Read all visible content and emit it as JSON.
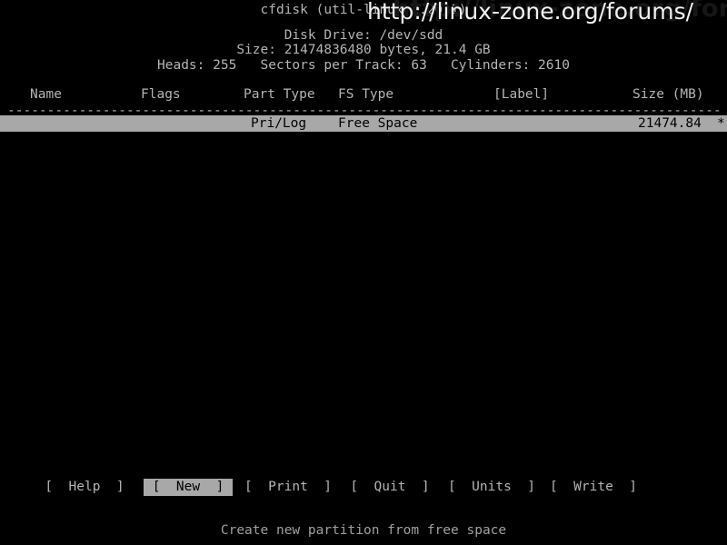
{
  "app": {
    "title": "cfdisk (util-linux 2.20.1)"
  },
  "disk_info": {
    "drive_line": "Disk Drive: /dev/sdd",
    "size_line": "Size: 21474836480 bytes, 21.4 GB",
    "geometry_line": "Heads: 255   Sectors per Track: 63   Cylinders: 2610",
    "drive": "/dev/sdd",
    "size_bytes": "21474836480",
    "size_human": "21.4 GB",
    "heads": "255",
    "sectors_per_track": "63",
    "cylinders": "2610"
  },
  "table": {
    "separator": "-------------------------------------------------------------------------------------------------------",
    "columns": {
      "name": "Name",
      "flags": "Flags",
      "part_type": "Part Type",
      "fs_type": "FS Type",
      "label": "[Label]",
      "size_mb": "Size (MB)"
    },
    "rows": [
      {
        "name": "",
        "flags": "",
        "part_type": "Pri/Log",
        "fs_type": "Free Space",
        "label": "",
        "size_mb": "21474.84",
        "more_marker": "*",
        "selected": true
      }
    ]
  },
  "buttons": [
    {
      "bracket_open": "[",
      "label": "Help",
      "bracket_close": "]",
      "selected": false
    },
    {
      "bracket_open": "[",
      "label": "New",
      "bracket_close": "]",
      "selected": true
    },
    {
      "bracket_open": "[",
      "label": "Print",
      "bracket_close": "]",
      "selected": false
    },
    {
      "bracket_open": "[",
      "label": "Quit",
      "bracket_close": "]",
      "selected": false
    },
    {
      "bracket_open": "[",
      "label": "Units",
      "bracket_close": "]",
      "selected": false
    },
    {
      "bracket_open": "[",
      "label": "Write",
      "bracket_close": "]",
      "selected": false
    }
  ],
  "status": {
    "help_text": "Create new partition from free space"
  },
  "watermarks": {
    "primary": "http://linux-zone.org/forums/",
    "secondary": "http://linux-zone.org/forums/.com"
  },
  "colors": {
    "background": "#000000",
    "foreground": "#b4b4b4",
    "highlight_bg": "#a8a8a8",
    "highlight_fg": "#000000",
    "watermark": "#f2f2f2"
  }
}
